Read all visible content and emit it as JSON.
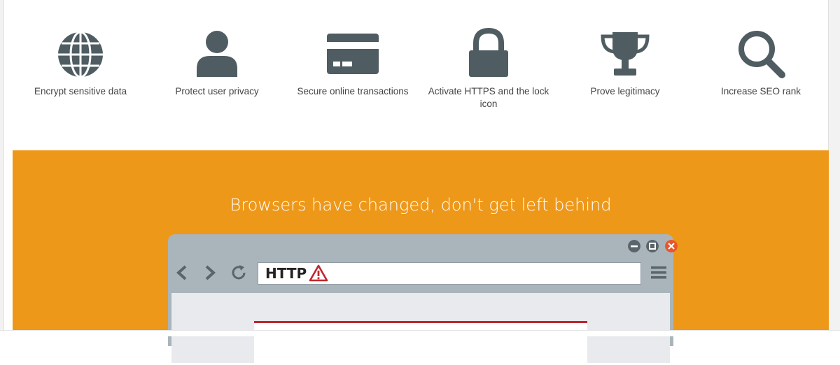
{
  "features": [
    {
      "icon": "globe-icon",
      "label": "Encrypt sensitive data"
    },
    {
      "icon": "user-icon",
      "label": "Protect user privacy"
    },
    {
      "icon": "credit-card-icon",
      "label": "Secure online transactions"
    },
    {
      "icon": "lock-icon",
      "label": "Activate HTTPS and the lock icon"
    },
    {
      "icon": "trophy-icon",
      "label": "Prove legitimacy"
    },
    {
      "icon": "search-icon",
      "label": "Increase SEO rank"
    }
  ],
  "banner": {
    "title": "Browsers have changed, don't get left behind",
    "background": "#ee981a"
  },
  "browser": {
    "address_text": "HTTP",
    "warning_icon": "warning-icon",
    "close_color": "#e8562a",
    "control_color": "#59656b"
  },
  "colors": {
    "icon": "#4f5d62",
    "text": "#444444"
  }
}
